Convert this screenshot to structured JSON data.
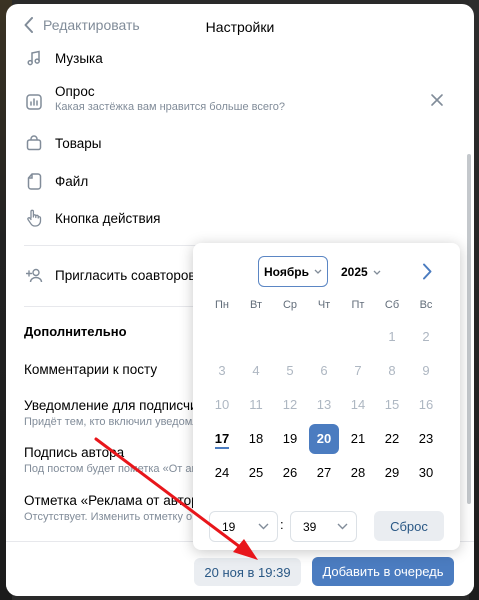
{
  "header": {
    "back_label": "Редактировать",
    "title": "Настройки"
  },
  "attachments": [
    {
      "label": "Музыка",
      "icon": "music-note-icon"
    },
    {
      "label": "Опрос",
      "sub": "Какая застёжка вам нравится больше всего?",
      "icon": "poll-icon"
    },
    {
      "label": "Товары",
      "icon": "shopping-bag-icon"
    },
    {
      "label": "Файл",
      "icon": "file-icon"
    },
    {
      "label": "Кнопка действия",
      "icon": "hand-pointer-icon"
    }
  ],
  "invite": {
    "label": "Пригласить соавторов",
    "icon": "add-user-icon"
  },
  "extra": {
    "heading": "Дополнительно",
    "items": [
      {
        "title": "Комментарии к посту",
        "sub": ""
      },
      {
        "title": "Уведомление для подписчиков",
        "sub": "Придёт тем, кто включил уведомления"
      },
      {
        "title": "Подпись автора",
        "sub": "Под постом будет пометка «От автора»"
      },
      {
        "title": "Отметка «Реклама от автора»",
        "sub": "Отсутствует. Изменить отметку о рекламе"
      }
    ]
  },
  "calendar": {
    "month": "Ноябрь",
    "year": "2025",
    "weekdays": [
      "Пн",
      "Вт",
      "Ср",
      "Чт",
      "Пт",
      "Сб",
      "Вс"
    ],
    "weeks": [
      [
        "",
        "",
        "",
        "",
        "",
        "1",
        "2"
      ],
      [
        "3",
        "4",
        "5",
        "6",
        "7",
        "8",
        "9"
      ],
      [
        "10",
        "11",
        "12",
        "13",
        "14",
        "15",
        "16"
      ],
      [
        "17",
        "18",
        "19",
        "20",
        "21",
        "22",
        "23"
      ],
      [
        "24",
        "25",
        "26",
        "27",
        "28",
        "29",
        "30"
      ]
    ],
    "today": "17",
    "selected": "20",
    "hour": "19",
    "minute": "39",
    "reset_label": "Сброс",
    "accent": "#4b7cc0"
  },
  "footer": {
    "date_button": "20 ноя в 19:39",
    "queue_button": "Добавить в очередь"
  }
}
